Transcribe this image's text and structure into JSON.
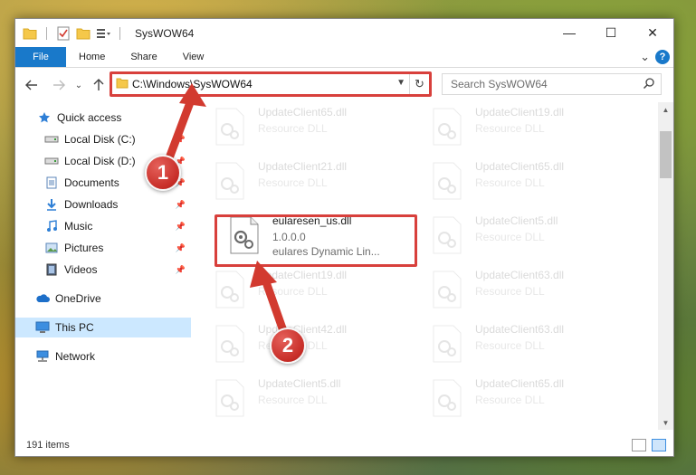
{
  "window": {
    "title": "SysWOW64",
    "controls": {
      "minimize": "—",
      "maximize": "☐",
      "close": "✕"
    }
  },
  "ribbon": {
    "tabs": [
      {
        "label": "File"
      },
      {
        "label": "Home"
      },
      {
        "label": "Share"
      },
      {
        "label": "View"
      }
    ],
    "help": "?",
    "expand": "⌄"
  },
  "address_bar": {
    "path": "C:\\Windows\\SysWOW64",
    "search_placeholder": "Search SysWOW64"
  },
  "sidebar": {
    "quick_access": "Quick access",
    "items": [
      {
        "label": "Local Disk (C:)",
        "icon": "drive-icon",
        "pinned": true
      },
      {
        "label": "Local Disk (D:)",
        "icon": "drive-icon",
        "pinned": true
      },
      {
        "label": "Documents",
        "icon": "documents-icon",
        "pinned": true
      },
      {
        "label": "Downloads",
        "icon": "downloads-icon",
        "pinned": true
      },
      {
        "label": "Music",
        "icon": "music-icon",
        "pinned": true
      },
      {
        "label": "Pictures",
        "icon": "pictures-icon",
        "pinned": true
      },
      {
        "label": "Videos",
        "icon": "videos-icon",
        "pinned": true
      }
    ],
    "onedrive": "OneDrive",
    "this_pc": "This PC",
    "network": "Network"
  },
  "files": [
    {
      "name": "UpdateClient65.dll",
      "desc": "Resource DLL",
      "faded": true
    },
    {
      "name": "UpdateClient19.dll",
      "desc": "Resource DLL",
      "faded": true
    },
    {
      "name": "UpdateClient21.dll",
      "desc": "Resource DLL",
      "faded": true
    },
    {
      "name": "UpdateClient65.dll",
      "desc": "Resource DLL",
      "faded": true
    },
    {
      "name": "eularesen_us.dll",
      "version": "1.0.0.0",
      "desc": "eulares Dynamic Lin...",
      "faded": false
    },
    {
      "name": "UpdateClient5.dll",
      "desc": "Resource DLL",
      "faded": true
    },
    {
      "name": "UpdateClient19.dll",
      "desc": "Resource DLL",
      "faded": true
    },
    {
      "name": "UpdateClient63.dll",
      "desc": "Resource DLL",
      "faded": true
    },
    {
      "name": "UpdateClient42.dll",
      "desc": "Resource DLL",
      "faded": true
    },
    {
      "name": "UpdateClient63.dll",
      "desc": "Resource DLL",
      "faded": true
    },
    {
      "name": "UpdateClient5.dll",
      "desc": "Resource DLL",
      "faded": true
    },
    {
      "name": "UpdateClient65.dll",
      "desc": "Resource DLL",
      "faded": true
    }
  ],
  "status": {
    "item_count": "191 items"
  },
  "annotations": {
    "step1": "1",
    "step2": "2"
  },
  "colors": {
    "accent": "#1979ca",
    "highlight": "#d8403c",
    "selection": "#cce8ff"
  }
}
